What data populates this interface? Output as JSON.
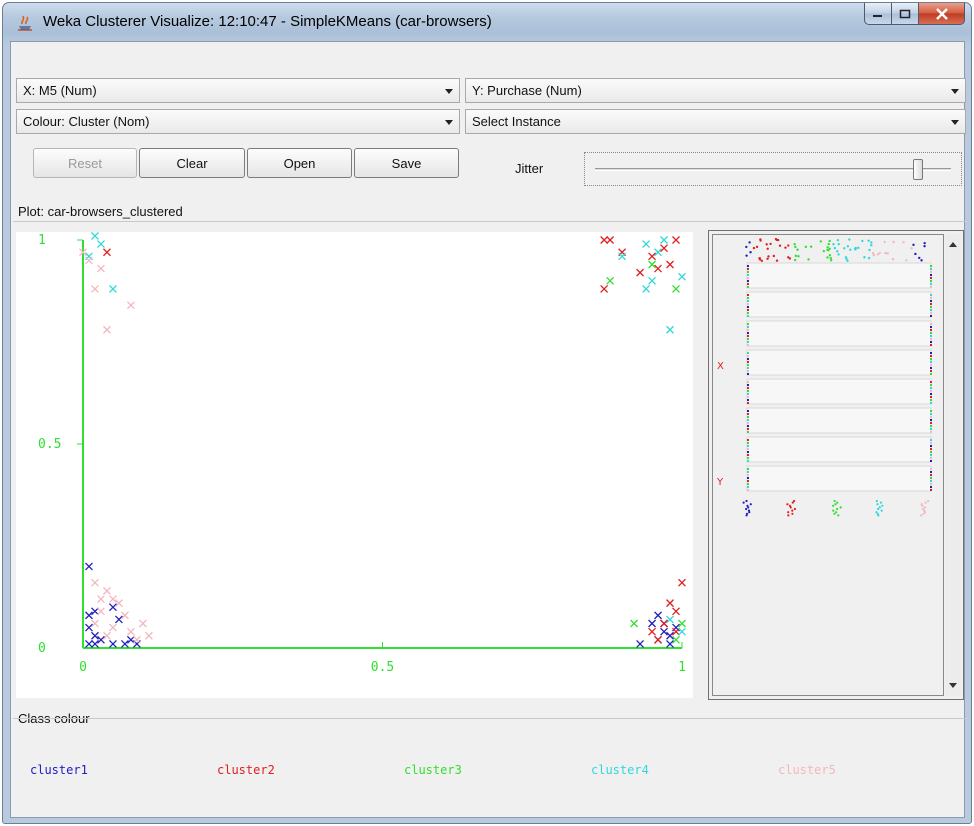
{
  "window": {
    "title": "Weka Clusterer Visualize: 12:10:47 - SimpleKMeans (car-browsers)"
  },
  "controls": {
    "x_axis": "X: M5 (Num)",
    "y_axis": "Y: Purchase (Num)",
    "colour": "Colour: Cluster (Nom)",
    "select_instance": "Select Instance",
    "reset": "Reset",
    "clear": "Clear",
    "open": "Open",
    "save": "Save",
    "jitter_label": "Jitter"
  },
  "plot": {
    "label": "Plot: car-browsers_clustered"
  },
  "matrix": {
    "x_label": "X",
    "y_label": "Y"
  },
  "class_colour": {
    "label": "Class colour",
    "items": [
      {
        "name": "cluster1",
        "color": "#2020c0"
      },
      {
        "name": "cluster2",
        "color": "#e02020"
      },
      {
        "name": "cluster3",
        "color": "#30e030"
      },
      {
        "name": "cluster4",
        "color": "#30d8d8"
      },
      {
        "name": "cluster5",
        "color": "#f2b8c0"
      }
    ]
  },
  "chart_data": {
    "type": "scatter",
    "title": "",
    "xlabel": "",
    "ylabel": "",
    "xlim": [
      0,
      1
    ],
    "ylim": [
      0,
      1
    ],
    "x_ticks": [
      "0",
      "0.5",
      "1"
    ],
    "y_ticks": [
      "0",
      "0.5",
      "1"
    ],
    "marker": "x",
    "axis_color": "#30e030",
    "series": [
      {
        "name": "cluster1",
        "color": "#2020c0",
        "points": [
          [
            0.01,
            0.2
          ],
          [
            0.01,
            0.08
          ],
          [
            0.02,
            0.09
          ],
          [
            0.01,
            0.05
          ],
          [
            0.02,
            0.03
          ],
          [
            0.01,
            0.01
          ],
          [
            0.02,
            0.01
          ],
          [
            0.03,
            0.02
          ],
          [
            0.05,
            0.1
          ],
          [
            0.06,
            0.07
          ],
          [
            0.08,
            0.02
          ],
          [
            0.05,
            0.01
          ],
          [
            0.07,
            0.01
          ],
          [
            0.09,
            0.01
          ],
          [
            0.93,
            0.01
          ],
          [
            0.95,
            0.06
          ],
          [
            0.96,
            0.08
          ],
          [
            0.97,
            0.04
          ],
          [
            0.98,
            0.03
          ],
          [
            0.96,
            0.02
          ],
          [
            0.99,
            0.05
          ],
          [
            0.98,
            0.01
          ],
          [
            0.97,
            0.06
          ]
        ]
      },
      {
        "name": "cluster2",
        "color": "#e02020",
        "points": [
          [
            0.04,
            0.97
          ],
          [
            0.87,
            1.0
          ],
          [
            0.88,
            1.0
          ],
          [
            0.9,
            0.97
          ],
          [
            0.93,
            0.92
          ],
          [
            0.95,
            0.96
          ],
          [
            0.96,
            0.93
          ],
          [
            0.97,
            0.98
          ],
          [
            0.99,
            1.0
          ],
          [
            0.98,
            0.94
          ],
          [
            0.87,
            0.88
          ],
          [
            1.0,
            0.16
          ],
          [
            0.98,
            0.11
          ],
          [
            0.99,
            0.09
          ],
          [
            0.97,
            0.06
          ],
          [
            0.95,
            0.04
          ],
          [
            0.96,
            0.02
          ],
          [
            0.99,
            0.04
          ]
        ]
      },
      {
        "name": "cluster3",
        "color": "#30e030",
        "points": [
          [
            0.88,
            0.9
          ],
          [
            0.95,
            0.94
          ],
          [
            0.99,
            0.88
          ],
          [
            0.92,
            0.06
          ],
          [
            0.99,
            0.02
          ],
          [
            1.0,
            0.06
          ]
        ]
      },
      {
        "name": "cluster4",
        "color": "#30d8d8",
        "points": [
          [
            0.02,
            1.01
          ],
          [
            0.03,
            0.99
          ],
          [
            0.01,
            0.96
          ],
          [
            0.05,
            0.88
          ],
          [
            0.94,
            0.99
          ],
          [
            0.96,
            0.97
          ],
          [
            0.97,
            1.0
          ],
          [
            0.9,
            0.96
          ],
          [
            0.94,
            0.88
          ],
          [
            0.95,
            0.9
          ],
          [
            1.0,
            0.91
          ],
          [
            0.98,
            0.78
          ],
          [
            0.98,
            0.07
          ],
          [
            1.0,
            0.04
          ]
        ]
      },
      {
        "name": "cluster5",
        "color": "#f2b8c0",
        "points": [
          [
            0.0,
            0.97
          ],
          [
            0.01,
            0.95
          ],
          [
            0.03,
            0.93
          ],
          [
            0.02,
            0.88
          ],
          [
            0.08,
            0.84
          ],
          [
            0.04,
            0.78
          ],
          [
            0.02,
            0.16
          ],
          [
            0.04,
            0.14
          ],
          [
            0.05,
            0.12
          ],
          [
            0.06,
            0.11
          ],
          [
            0.03,
            0.09
          ],
          [
            0.02,
            0.06
          ],
          [
            0.05,
            0.05
          ],
          [
            0.08,
            0.04
          ],
          [
            0.1,
            0.06
          ],
          [
            0.04,
            0.03
          ],
          [
            0.07,
            0.08
          ],
          [
            0.03,
            0.12
          ],
          [
            0.09,
            0.02
          ],
          [
            0.11,
            0.03
          ]
        ]
      }
    ]
  }
}
